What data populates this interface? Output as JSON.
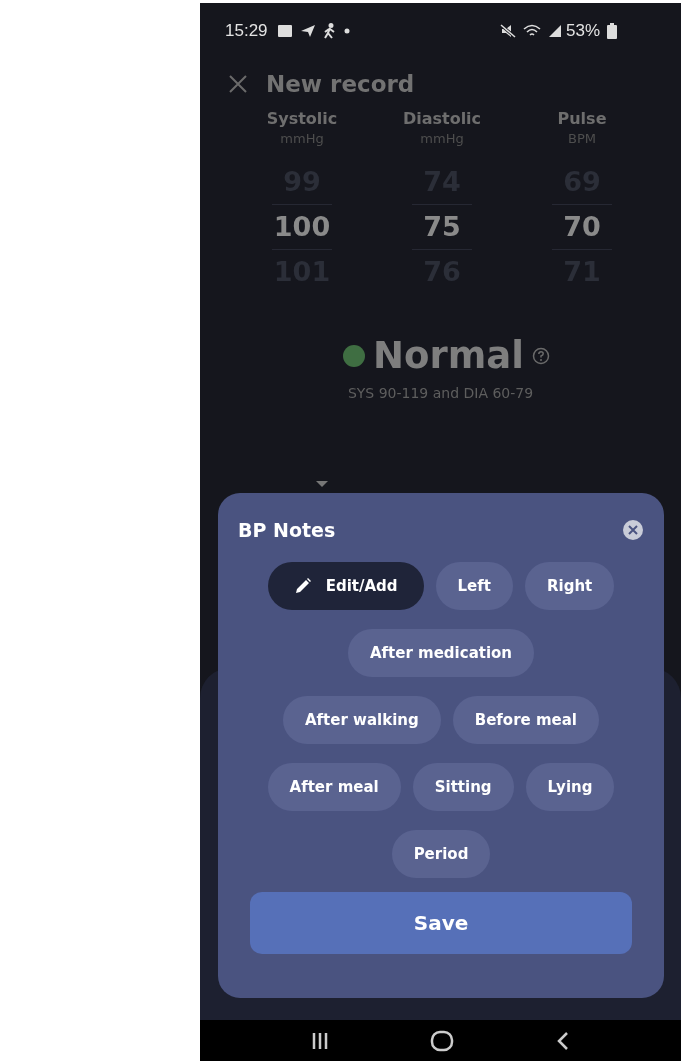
{
  "status_bar": {
    "time": "15:29",
    "battery": "53%"
  },
  "header": {
    "title": "New record"
  },
  "pickers": [
    {
      "label": "Systolic",
      "unit": "mmHg",
      "previous": "99",
      "value": "100",
      "next": "101"
    },
    {
      "label": "Diastolic",
      "unit": "mmHg",
      "previous": "74",
      "value": "75",
      "next": "76"
    },
    {
      "label": "Pulse",
      "unit": "BPM",
      "previous": "69",
      "value": "70",
      "next": "71"
    }
  ],
  "category": {
    "label": "Normal",
    "color": "#3f6e42",
    "range": "SYS 90-119 and DIA 60-79"
  },
  "notes_sheet": {
    "title": "BP Notes",
    "chips": [
      {
        "kind": "action",
        "label": "Edit/Add",
        "selected": false
      },
      {
        "kind": "tag",
        "label": "Left",
        "selected": false
      },
      {
        "kind": "tag",
        "label": "Right",
        "selected": false
      },
      {
        "kind": "tag",
        "label": "After medication",
        "selected": false
      },
      {
        "kind": "tag",
        "label": "After walking",
        "selected": false
      },
      {
        "kind": "tag",
        "label": "Before meal",
        "selected": false
      },
      {
        "kind": "tag",
        "label": "After meal",
        "selected": false
      },
      {
        "kind": "tag",
        "label": "Sitting",
        "selected": false
      },
      {
        "kind": "tag",
        "label": "Lying",
        "selected": false
      },
      {
        "kind": "tag",
        "label": "Period",
        "selected": false
      }
    ],
    "save_button": "Save"
  }
}
